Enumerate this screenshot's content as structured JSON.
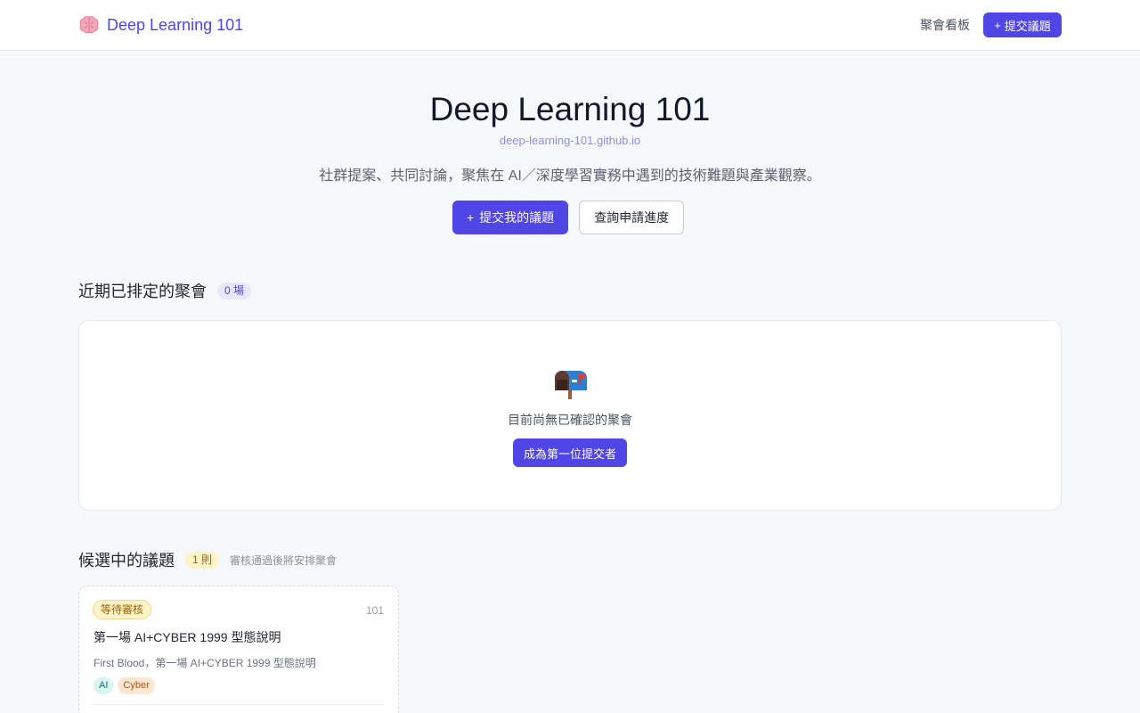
{
  "header": {
    "brand": "Deep Learning 101",
    "nav_link": "聚會看板",
    "submit_button": "提交議題",
    "plus": "+"
  },
  "hero": {
    "title": "Deep Learning 101",
    "domain": "deep-learning-101.github.io",
    "description": "社群提案、共同討論，聚焦在 AI／深度學習實務中遇到的技術難題與產業觀察。",
    "primary_button": "提交我的議題",
    "secondary_button": "查詢申請進度",
    "plus": "+"
  },
  "meetups": {
    "title": "近期已排定的聚會",
    "count": "0 場",
    "empty_text": "目前尚無已確認的聚會",
    "empty_button": "成為第一位提交者"
  },
  "candidates": {
    "title": "候選中的議題",
    "count": "1 則",
    "note": "審核通過後將安排聚會",
    "items": [
      {
        "status": "等待審核",
        "id": "101",
        "title": "第一場 AI+CYBER 1999 型態說明",
        "description": "First Blood，第一場 AI+CYBER 1999 型態說明",
        "tags": [
          "AI",
          "Cyber"
        ]
      }
    ]
  },
  "colors": {
    "accent": "#4f46e5",
    "pending": "#fdf3c8"
  }
}
